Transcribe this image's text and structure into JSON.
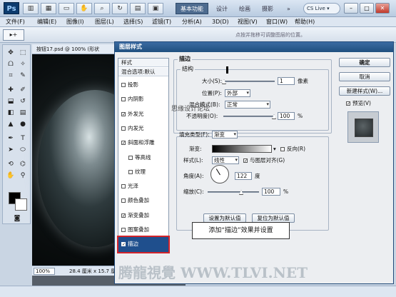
{
  "app": {
    "logo": "Ps",
    "workspaces": [
      "基本功能",
      "设计",
      "绘画",
      "摄影"
    ],
    "active_workspace": "基本功能",
    "more": "»",
    "cslive": "CS Live ▾",
    "window_controls": [
      "–",
      "□",
      "✕"
    ]
  },
  "menu": [
    "文件(F)",
    "编辑(E)",
    "图像(I)",
    "图层(L)",
    "选择(S)",
    "滤镜(T)",
    "分析(A)",
    "3D(D)",
    "视图(V)",
    "窗口(W)",
    "帮助(H)"
  ],
  "options": {
    "preset": "▸+",
    "hint": "点按并拖移可调整图层的位置。"
  },
  "document": {
    "tab": "按钮17.psd @ 100% (形状",
    "zoom": "100%",
    "size": "28.4 厘米 x 15.7 厘米 (72 ppi)"
  },
  "dialog": {
    "title": "图层样式",
    "styles_header": "样式",
    "blend_options": "混合选项:默认",
    "effects": [
      {
        "label": "投影",
        "checked": false,
        "indent": false
      },
      {
        "label": "内阴影",
        "checked": false,
        "indent": false
      },
      {
        "label": "外发光",
        "checked": true,
        "indent": false
      },
      {
        "label": "内发光",
        "checked": false,
        "indent": false
      },
      {
        "label": "斜面和浮雕",
        "checked": true,
        "indent": false
      },
      {
        "label": "等高线",
        "checked": false,
        "indent": true
      },
      {
        "label": "纹理",
        "checked": false,
        "indent": true
      },
      {
        "label": "光泽",
        "checked": false,
        "indent": false
      },
      {
        "label": "颜色叠加",
        "checked": false,
        "indent": false
      },
      {
        "label": "渐变叠加",
        "checked": true,
        "indent": false
      },
      {
        "label": "图案叠加",
        "checked": false,
        "indent": false
      },
      {
        "label": "描边",
        "checked": true,
        "indent": false,
        "selected": true
      }
    ],
    "section_title": "描边",
    "structure": {
      "title": "结构",
      "size_label": "大小(S):",
      "size_value": "1",
      "size_unit": "像素",
      "position_label": "位置(P):",
      "position_value": "外部",
      "blend_label": "混合模式(B):",
      "blend_value": "正常",
      "opacity_label": "不透明度(O):",
      "opacity_value": "100",
      "percent": "%"
    },
    "fill": {
      "type_label": "填充类型(F):",
      "type_value": "渐变",
      "gradient_label": "渐变:",
      "reverse_label": "反向(R)",
      "style_label": "样式(L):",
      "style_value": "线性",
      "align_label": "与图层对齐(G)",
      "angle_label": "角度(A):",
      "angle_value": "122",
      "angle_unit": "度",
      "scale_label": "缩放(C):",
      "scale_value": "100",
      "percent": "%"
    },
    "buttons": {
      "set_default": "设置为默认值",
      "reset_default": "复位为默认值"
    },
    "right": {
      "ok": "确定",
      "cancel": "取消",
      "new_style": "新建样式(W)...",
      "preview": "预览(V)"
    }
  },
  "annotation": "添加“描边”效果并设置",
  "watermarks": {
    "forum": "思缘设计论坛",
    "site": "腾龍視覺 WWW.TLVI.NET"
  }
}
